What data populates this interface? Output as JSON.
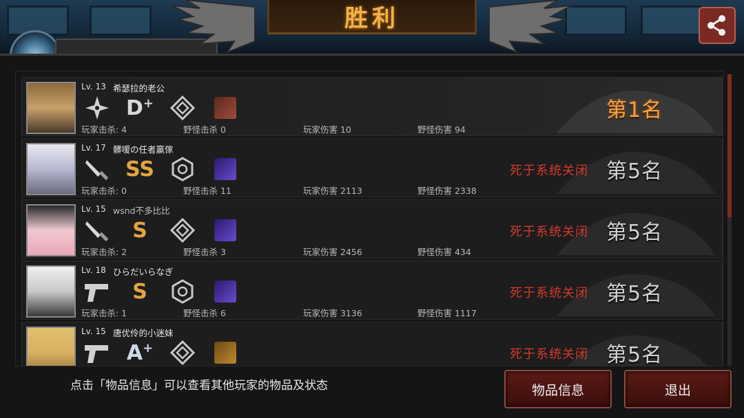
{
  "header": {
    "title": "胜利",
    "share_icon": "share-icon"
  },
  "players": [
    {
      "level": "Lv. 13",
      "name": "希瑟拉的老公",
      "weapon": "shuriken-icon",
      "grade": "D",
      "grade_suffix": "+",
      "rank_badge": "rank-diamond-icon",
      "item_color": "#5a2a1e",
      "kills_player": "玩家击杀: 4",
      "kills_monster": "野怪击杀 0",
      "damage_player": "玩家伤害 10",
      "damage_monster": "野怪伤害 94",
      "status": "",
      "rank": "第1名"
    },
    {
      "level": "Lv. 17",
      "name": "髒嗳の任者赢傢",
      "weapon": "knife-icon",
      "grade": "SS",
      "grade_suffix": "",
      "rank_badge": "rank-hexagon-icon",
      "item_color": "#3b2a8c",
      "kills_player": "玩家击杀: 0",
      "kills_monster": "野怪击杀 11",
      "damage_player": "玩家伤害 2113",
      "damage_monster": "野怪伤害 2338",
      "status": "死于系统关闭",
      "rank": "第5名"
    },
    {
      "level": "Lv. 15",
      "name": "wsnd不多比比",
      "weapon": "knife-icon",
      "grade": "S",
      "grade_suffix": "",
      "rank_badge": "rank-diamond-icon",
      "item_color": "#3b2a8c",
      "kills_player": "玩家击杀: 2",
      "kills_monster": "野怪击杀 3",
      "damage_player": "玩家伤害 2456",
      "damage_monster": "野怪伤害 434",
      "status": "死于系统关闭",
      "rank": "第5名"
    },
    {
      "level": "Lv. 18",
      "name": "ひらだいらなぎ",
      "weapon": "pistol-icon",
      "grade": "S",
      "grade_suffix": "",
      "rank_badge": "rank-hexagon-icon",
      "item_color": "#3b2a8c",
      "kills_player": "玩家击杀: 1",
      "kills_monster": "野怪击杀 6",
      "damage_player": "玩家伤害 3136",
      "damage_monster": "野怪伤害 1117",
      "status": "死于系统关闭",
      "rank": "第5名"
    },
    {
      "level": "Lv. 15",
      "name": "唐优伶的小迷妹",
      "weapon": "pistol-icon",
      "grade": "A",
      "grade_suffix": "+",
      "rank_badge": "rank-diamond-icon",
      "item_color": "#6a4a14",
      "kills_player": "",
      "kills_monster": "",
      "damage_player": "",
      "damage_monster": "",
      "status": "死于系统关闭",
      "rank": "第5名"
    }
  ],
  "footer": {
    "hint": "点击「物品信息」可以查看其他玩家的物品及状态",
    "items_button": "物品信息",
    "exit_button": "退出"
  },
  "colors": {
    "gold": "#f0a14a",
    "death_red": "#d43a2a",
    "button_red": "#5a1a16"
  }
}
